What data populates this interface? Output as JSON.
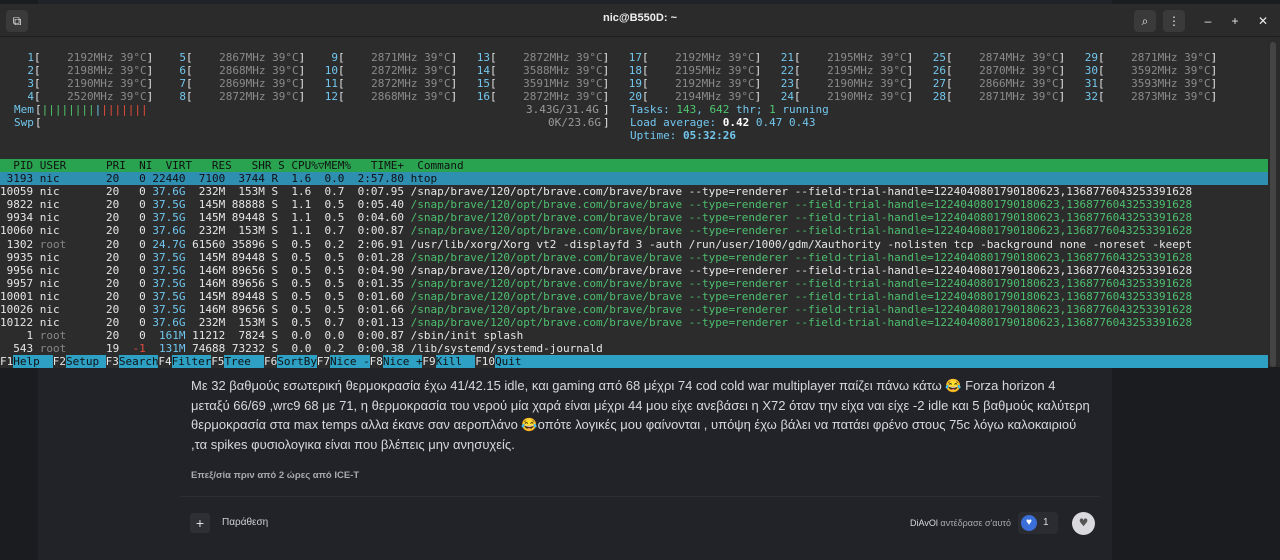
{
  "forum": {
    "post_text": "Με 32 βαθμούς εσωτερική θερμοκρασία έχω 41/42.15 idle, και gaming από 68 μέχρι 74 cod cold war multiplayer παίζει πάνω κάτω 😂 Forza horizon 4 μεταξύ 66/69 ,wrc9 68 με 71, η θερμοκρασία του νερού μία χαρά είναι μέχρι 44 μου είχε ανεβάσει η X72 όταν την είχα ναι είχε -2 idle και 5 βαθμούς καλύτερη θερμοκρασία στα max temps αλλα έκανε σαν αεροπλάνο 😂οπότε λογικές μου φαίνονται , υπόψη έχω βάλει να πατάει φρένο στους 75c λόγω καλοκαιριού ,τα spikes φυσιολογικα είναι που βλέπεις μην ανησυχείς.",
    "edited": "Επεξ/σία πριν από 2 ώρες από ICE-T",
    "quote_label": "Παράθεση",
    "reactor": "DiAvOl",
    "reacted_text": "αντέδρασε σ'αυτό",
    "reaction_count": "1"
  },
  "window": {
    "title": "nic@B550D: ~"
  },
  "htop": {
    "cpus": [
      [
        "1",
        "2192MHz",
        "39°C"
      ],
      [
        "2",
        "2198MHz",
        "39°C"
      ],
      [
        "3",
        "2190MHz",
        "39°C"
      ],
      [
        "4",
        "2520MHz",
        "39°C"
      ],
      [
        "5",
        "2867MHz",
        "39°C"
      ],
      [
        "6",
        "2868MHz",
        "39°C"
      ],
      [
        "7",
        "2869MHz",
        "39°C"
      ],
      [
        "8",
        "2872MHz",
        "39°C"
      ],
      [
        "9",
        "2871MHz",
        "39°C"
      ],
      [
        "10",
        "2872MHz",
        "39°C"
      ],
      [
        "11",
        "2872MHz",
        "39°C"
      ],
      [
        "12",
        "2868MHz",
        "39°C"
      ],
      [
        "13",
        "2872MHz",
        "39°C"
      ],
      [
        "14",
        "3588MHz",
        "39°C"
      ],
      [
        "15",
        "3591MHz",
        "39°C"
      ],
      [
        "16",
        "2872MHz",
        "39°C"
      ],
      [
        "17",
        "2192MHz",
        "39°C"
      ],
      [
        "18",
        "2195MHz",
        "39°C"
      ],
      [
        "19",
        "2192MHz",
        "39°C"
      ],
      [
        "20",
        "2194MHz",
        "39°C"
      ],
      [
        "21",
        "2195MHz",
        "39°C"
      ],
      [
        "22",
        "2195MHz",
        "39°C"
      ],
      [
        "23",
        "2190MHz",
        "39°C"
      ],
      [
        "24",
        "2190MHz",
        "39°C"
      ],
      [
        "25",
        "2874MHz",
        "39°C"
      ],
      [
        "26",
        "2870MHz",
        "39°C"
      ],
      [
        "27",
        "2866MHz",
        "39°C"
      ],
      [
        "28",
        "2871MHz",
        "39°C"
      ],
      [
        "29",
        "2871MHz",
        "39°C"
      ],
      [
        "30",
        "3592MHz",
        "39°C"
      ],
      [
        "31",
        "3593MHz",
        "39°C"
      ],
      [
        "32",
        "2873MHz",
        "39°C"
      ]
    ],
    "mem_label": "Mem",
    "swp_label": "Swp",
    "mem_value": "3.43G/31.4G",
    "swp_value": "0K/23.6G",
    "tasks_label": "Tasks:",
    "tasks_count": "143",
    "thr_count": "642",
    "thr_label": "thr;",
    "running_count": "1",
    "running_label": "running",
    "load_label": "Load average:",
    "load1": "0.42",
    "load5": "0.47",
    "load15": "0.43",
    "uptime_label": "Uptime:",
    "uptime": "05:32:26",
    "header": "  PID USER      PRI  NI  VIRT   RES   SHR S CPU%▽MEM%   TIME+  Command",
    "processes": [
      [
        "3193",
        "nic",
        "20",
        "0",
        "22440",
        "7100",
        "3744",
        "R",
        "1.6",
        "0.0",
        "2:57.80",
        "htop"
      ],
      [
        "10059",
        "nic",
        "20",
        "0",
        "37.6G",
        "232M",
        "153M",
        "S",
        "1.6",
        "0.7",
        "0:07.95",
        "/snap/brave/120/opt/brave.com/brave/brave --type=renderer --field-trial-handle=1224040801790180623,1368776043253391628"
      ],
      [
        "9822",
        "nic",
        "20",
        "0",
        "37.5G",
        "145M",
        "88888",
        "S",
        "1.1",
        "0.5",
        "0:05.40",
        "/snap/brave/120/opt/brave.com/brave/brave --type=renderer --field-trial-handle=1224040801790180623,1368776043253391628"
      ],
      [
        "9934",
        "nic",
        "20",
        "0",
        "37.5G",
        "145M",
        "89448",
        "S",
        "1.1",
        "0.5",
        "0:04.60",
        "/snap/brave/120/opt/brave.com/brave/brave --type=renderer --field-trial-handle=1224040801790180623,1368776043253391628"
      ],
      [
        "10060",
        "nic",
        "20",
        "0",
        "37.6G",
        "232M",
        "153M",
        "S",
        "1.1",
        "0.7",
        "0:00.87",
        "/snap/brave/120/opt/brave.com/brave/brave --type=renderer --field-trial-handle=1224040801790180623,1368776043253391628"
      ],
      [
        "1302",
        "root",
        "20",
        "0",
        "24.7G",
        "61560",
        "35896",
        "S",
        "0.5",
        "0.2",
        "2:06.91",
        "/usr/lib/xorg/Xorg vt2 -displayfd 3 -auth /run/user/1000/gdm/Xauthority -nolisten tcp -background none -noreset -keept"
      ],
      [
        "9935",
        "nic",
        "20",
        "0",
        "37.5G",
        "145M",
        "89448",
        "S",
        "0.5",
        "0.5",
        "0:01.28",
        "/snap/brave/120/opt/brave.com/brave/brave --type=renderer --field-trial-handle=1224040801790180623,1368776043253391628"
      ],
      [
        "9956",
        "nic",
        "20",
        "0",
        "37.5G",
        "146M",
        "89656",
        "S",
        "0.5",
        "0.5",
        "0:04.90",
        "/snap/brave/120/opt/brave.com/brave/brave --type=renderer --field-trial-handle=1224040801790180623,1368776043253391628"
      ],
      [
        "9957",
        "nic",
        "20",
        "0",
        "37.5G",
        "146M",
        "89656",
        "S",
        "0.5",
        "0.5",
        "0:01.35",
        "/snap/brave/120/opt/brave.com/brave/brave --type=renderer --field-trial-handle=1224040801790180623,1368776043253391628"
      ],
      [
        "10001",
        "nic",
        "20",
        "0",
        "37.5G",
        "145M",
        "89448",
        "S",
        "0.5",
        "0.5",
        "0:01.60",
        "/snap/brave/120/opt/brave.com/brave/brave --type=renderer --field-trial-handle=1224040801790180623,1368776043253391628"
      ],
      [
        "10026",
        "nic",
        "20",
        "0",
        "37.5G",
        "146M",
        "89656",
        "S",
        "0.5",
        "0.5",
        "0:01.66",
        "/snap/brave/120/opt/brave.com/brave/brave --type=renderer --field-trial-handle=1224040801790180623,1368776043253391628"
      ],
      [
        "10122",
        "nic",
        "20",
        "0",
        "37.6G",
        "232M",
        "153M",
        "S",
        "0.5",
        "0.7",
        "0:01.13",
        "/snap/brave/120/opt/brave.com/brave/brave --type=renderer --field-trial-handle=1224040801790180623,1368776043253391628"
      ],
      [
        "1",
        "root",
        "20",
        "0",
        "161M",
        "11212",
        "7824",
        "S",
        "0.0",
        "0.0",
        "0:00.87",
        "/sbin/init splash"
      ],
      [
        "543",
        "root",
        "19",
        "-1",
        "131M",
        "74688",
        "73232",
        "S",
        "0.0",
        "0.2",
        "0:00.38",
        "/lib/systemd/systemd-journald"
      ]
    ],
    "thread_rows": [
      false,
      false,
      true,
      true,
      true,
      false,
      true,
      false,
      true,
      true,
      true,
      true,
      false,
      false
    ],
    "fkeys": [
      [
        "F1",
        "Help  "
      ],
      [
        "F2",
        "Setup "
      ],
      [
        "F3",
        "Search"
      ],
      [
        "F4",
        "Filter"
      ],
      [
        "F5",
        "Tree  "
      ],
      [
        "F6",
        "SortBy"
      ],
      [
        "F7",
        "Nice -"
      ],
      [
        "F8",
        "Nice +"
      ],
      [
        "F9",
        "Kill  "
      ],
      [
        "F10",
        "Quit"
      ]
    ]
  }
}
